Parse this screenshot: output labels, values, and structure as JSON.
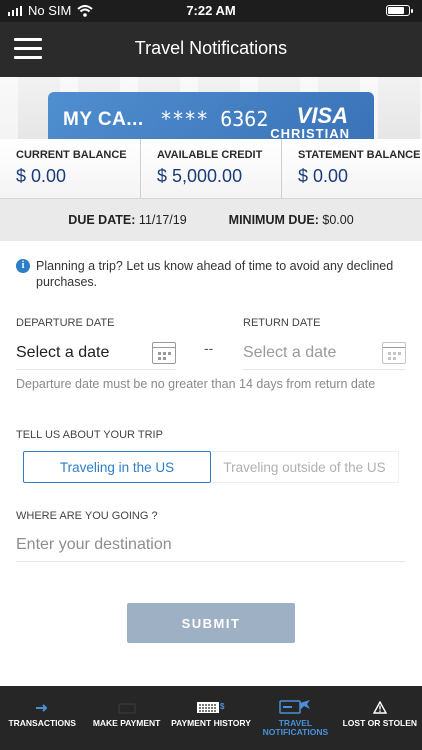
{
  "status_bar": {
    "carrier": "No SIM",
    "time": "7:22 AM",
    "battery_level": 0.85
  },
  "header": {
    "title": "Travel Notifications",
    "menu_icon": "hamburger-menu-icon"
  },
  "card": {
    "name": "MY CA...",
    "masked_number": "**** 6362",
    "brand": "VISA",
    "subbrand": "CHRISTIAN"
  },
  "balances": [
    {
      "label": "CURRENT BALANCE",
      "value": "$ 0.00"
    },
    {
      "label": "AVAILABLE CREDIT",
      "value": "$ 5,000.00"
    },
    {
      "label": "STATEMENT BALANCE",
      "value": "$ 0.00"
    }
  ],
  "due": {
    "due_date_label": "DUE DATE:",
    "due_date_value": "11/17/19",
    "minimum_label": "MINIMUM DUE:",
    "minimum_value": "$0.00"
  },
  "info_text": "Planning a trip? Let us know ahead of time to avoid any declined purchases.",
  "departure": {
    "label": "DEPARTURE DATE",
    "value": "Select a date"
  },
  "separator": "--",
  "return": {
    "label": "RETURN DATE",
    "placeholder": "Select a date"
  },
  "date_hint": "Departure date must be no greater than 14 days from return date",
  "trip": {
    "label": "TELL US ABOUT YOUR TRIP",
    "options": [
      "Traveling in the US",
      "Traveling outside of the US"
    ],
    "selected": "Traveling in the US"
  },
  "destination": {
    "label": "WHERE ARE YOU GOING ?",
    "placeholder": "Enter your destination"
  },
  "submit_label": "SUBMIT",
  "colors": {
    "accent": "#2d7ec8",
    "balance_value": "#1a3d7a",
    "nav_background": "#2b2b2b",
    "submit_background": "#9eb0c3"
  },
  "tabs": [
    {
      "label": "TRANSACTIONS",
      "icon": "transactions-icon",
      "active": false
    },
    {
      "label": "MAKE PAYMENT",
      "icon": "make-payment-icon",
      "active": false
    },
    {
      "label": "PAYMENT HISTORY",
      "icon": "payment-history-icon",
      "active": false
    },
    {
      "label": "TRAVEL NOTIFICATIONS",
      "icon": "travel-notifications-icon",
      "active": true
    },
    {
      "label": "LOST OR STOLEN",
      "icon": "warning-icon",
      "active": false
    }
  ]
}
